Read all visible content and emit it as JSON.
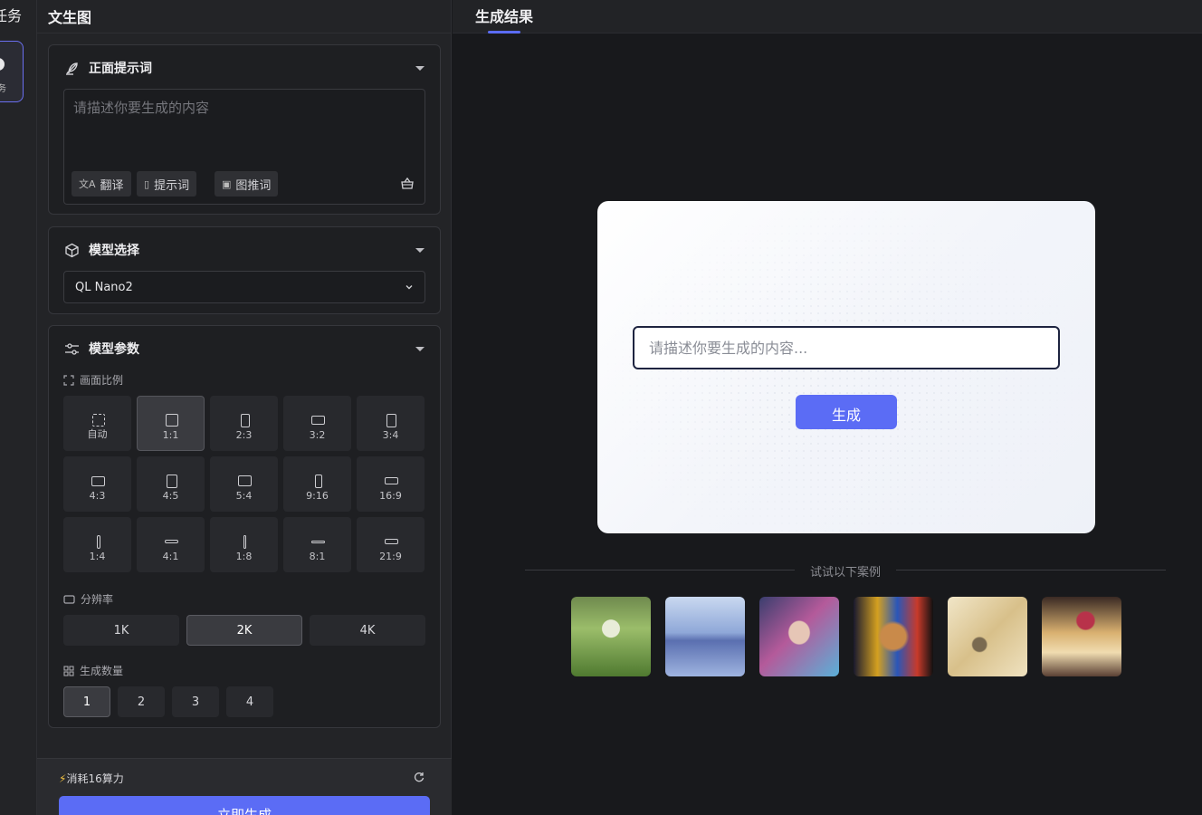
{
  "left_rail": {
    "title": "任务",
    "item_label": "务"
  },
  "panel": {
    "title": "文生图",
    "prompt_card": {
      "title": "正面提示词",
      "placeholder": "请描述你要生成的内容",
      "tools": [
        "翻译",
        "提示词",
        "图推词"
      ]
    },
    "model_card": {
      "title": "模型选择",
      "selected": "QL Nano2"
    },
    "params_card": {
      "title": "模型参数",
      "ratio_label": "画面比例",
      "ratios": [
        "自动",
        "1:1",
        "2:3",
        "3:2",
        "3:4",
        "4:3",
        "4:5",
        "5:4",
        "9:16",
        "16:9",
        "1:4",
        "4:1",
        "1:8",
        "8:1",
        "21:9"
      ],
      "ratio_selected": "1:1",
      "resolution_label": "分辨率",
      "resolutions": [
        "1K",
        "2K",
        "4K"
      ],
      "resolution_selected": "2K",
      "count_label": "生成数量",
      "counts": [
        "1",
        "2",
        "3",
        "4"
      ],
      "count_selected": "1"
    },
    "footer": {
      "cost": "消耗16算力",
      "generate": "立即生成"
    }
  },
  "result": {
    "tab": "生成结果",
    "placeholder": "请描述你要生成的内容...",
    "generate": "生成",
    "examples_label": "试试以下案例"
  },
  "colors": {
    "accent": "#5b6cf5",
    "panel_bg": "#232427",
    "card_bg": "#1e1f22"
  }
}
